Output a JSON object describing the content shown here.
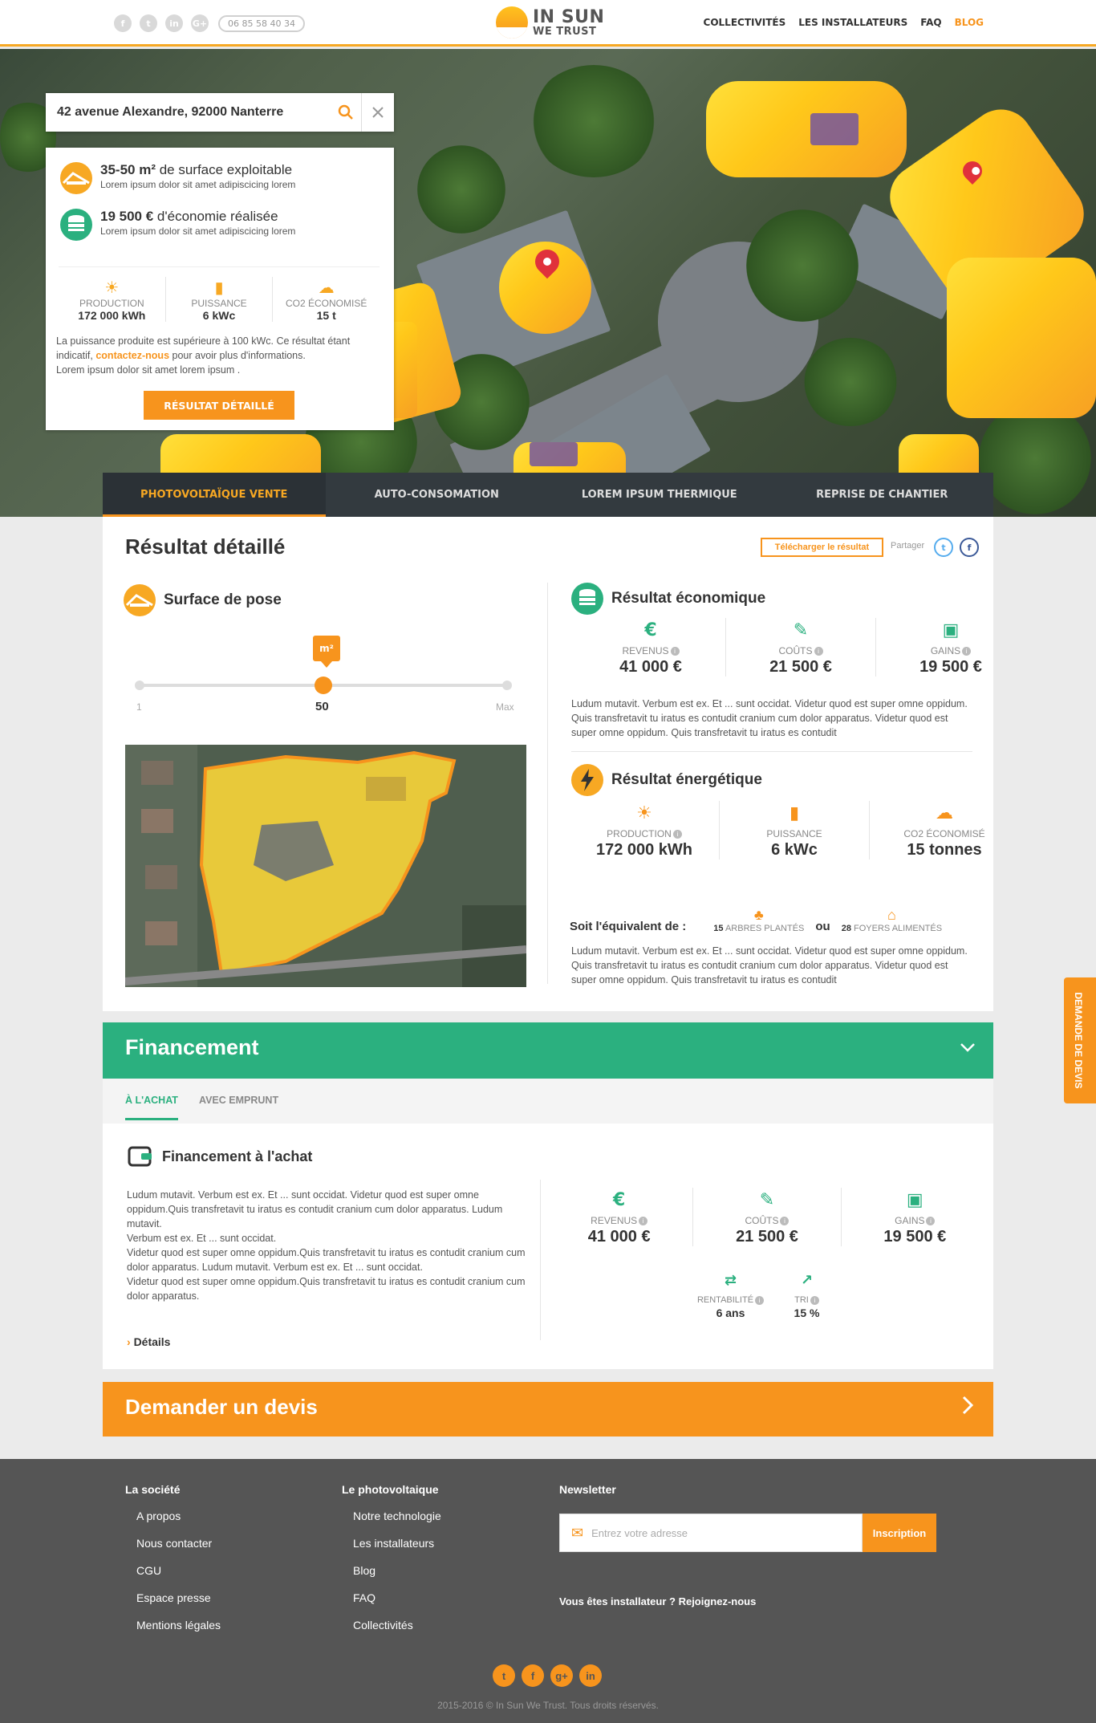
{
  "header": {
    "socials": [
      "f",
      "t",
      "in",
      "G+"
    ],
    "phone": "06 85 58 40 34",
    "logo_line1": "IN SUN",
    "logo_line2": "WE TRUST",
    "nav": [
      "COLLECTIVITÉS",
      "LES INSTALLATEURS",
      "FAQ",
      "BLOG"
    ]
  },
  "search": {
    "address": "42 avenue Alexandre, 92000 Nanterre"
  },
  "panel": {
    "surface_bold": "35-50 m²",
    "surface_text": " de surface exploitable",
    "surface_sub": "Lorem ipsum dolor sit amet adipiscicing lorem",
    "eco_bold": "19 500 €",
    "eco_text": " d'économie réalisée",
    "eco_sub": "Lorem ipsum dolor sit amet adipiscicing lorem",
    "stats": [
      {
        "label": "PRODUCTION",
        "value": "172 000 kWh"
      },
      {
        "label": "PUISSANCE",
        "value": "6 kWc"
      },
      {
        "label": "CO2 ÉCONOMISÉ",
        "value": "15 t"
      }
    ],
    "note_1": "La puissance produite est supérieure à 100 kWc. Ce résultat étant indicatif, ",
    "note_link": "contactez-nous",
    "note_2": " pour avoir plus d'informations.",
    "note_3": "Lorem ipsum dolor sit amet lorem ipsum .",
    "button": "RÉSULTAT DÉTAILLÉ"
  },
  "tabs": [
    "PHOTOVOLTAÏQUE VENTE",
    "AUTO-CONSOMATION",
    "LOREM IPSUM THERMIQUE",
    "REPRISE DE CHANTIER"
  ],
  "result": {
    "title": "Résultat détaillé",
    "download": "Télécharger le résultat",
    "share": "Partager",
    "surface_title": "Surface de pose",
    "slider_unit": "m²",
    "slider_min": "1",
    "slider_value": "50",
    "slider_max": "Max",
    "slider_fraction": 0.5,
    "eco_title": "Résultat économique",
    "eco_stats": [
      {
        "label": "REVENUS",
        "value": "41 000 €"
      },
      {
        "label": "COÛTS",
        "value": "21 500 €"
      },
      {
        "label": "GAINS",
        "value": "19 500 €"
      }
    ],
    "eco_text": "Ludum mutavit. Verbum est ex. Et ... sunt occidat. Videtur quod est super omne oppidum. Quis transfretavit tu iratus es contudit cranium cum dolor apparatus. Videtur quod est super omne oppidum. Quis transfretavit tu iratus es contudit",
    "energy_title": "Résultat énergétique",
    "energy_stats": [
      {
        "label": "PRODUCTION",
        "value": "172 000 kWh"
      },
      {
        "label": "PUISSANCE",
        "value": "6 kWc"
      },
      {
        "label": "CO2 ÉCONOMISÉ",
        "value": "15 tonnes"
      }
    ],
    "equiv_label": "Soit l'équivalent de :",
    "equiv_trees_num": "15",
    "equiv_trees": "ARBRES PLANTÉS",
    "equiv_or": "ou",
    "equiv_homes_num": "28",
    "equiv_homes": "FOYERS ALIMENTÉS",
    "energy_text": "Ludum mutavit. Verbum est ex. Et ... sunt occidat. Videtur quod est super omne oppidum. Quis transfretavit tu iratus es contudit cranium cum dolor apparatus. Videtur quod est super omne oppidum. Quis transfretavit tu iratus es contudit"
  },
  "financement": {
    "title": "Financement",
    "tab_achat": "À L'ACHAT",
    "tab_emprunt": "AVEC EMPRUNT",
    "sub_title": "Financement à l'achat",
    "text": "Ludum mutavit. Verbum est ex. Et ... sunt occidat. Videtur quod est super omne oppidum.Quis transfretavit tu iratus es contudit cranium cum dolor apparatus. Ludum mutavit.\nVerbum est ex. Et ... sunt occidat.\nVidetur quod est super omne oppidum.Quis transfretavit tu iratus es contudit cranium cum dolor apparatus. Ludum mutavit. Verbum est ex. Et ... sunt occidat.\nVidetur quod est super omne oppidum.Quis transfretavit tu iratus es contudit cranium cum dolor apparatus.",
    "details": "Détails",
    "stats": [
      {
        "label": "REVENUS",
        "value": "41 000 €"
      },
      {
        "label": "COÛTS",
        "value": "21 500 €"
      },
      {
        "label": "GAINS",
        "value": "19 500 €"
      }
    ],
    "rent_label": "RENTABILITÉ",
    "rent_value": "6 ans",
    "tri_label": "TRI",
    "tri_value": "15 %"
  },
  "devis": {
    "title": "Demander un devis",
    "side": "DEMANDE DE DEVIS"
  },
  "footer": {
    "col1_title": "La société",
    "col1": [
      "A propos",
      "Nous contacter",
      "CGU",
      "Espace presse",
      "Mentions légales"
    ],
    "col2_title": "Le photovoltaique",
    "col2": [
      "Notre technologie",
      "Les installateurs",
      "Blog",
      "FAQ",
      "Collectivités"
    ],
    "newsletter_title": "Newsletter",
    "newsletter_placeholder": "Entrez votre adresse",
    "newsletter_button": "Inscription",
    "join": "Vous êtes installateur ? Rejoignez-nous",
    "socials": [
      "t",
      "f",
      "g+",
      "in"
    ],
    "copyright": "2015-2016 © In Sun We Trust. Tous droits réservés."
  },
  "colors": {
    "orange": "#f7941d",
    "green": "#2bb07f",
    "dark": "#333a3f",
    "footer": "#555555"
  }
}
